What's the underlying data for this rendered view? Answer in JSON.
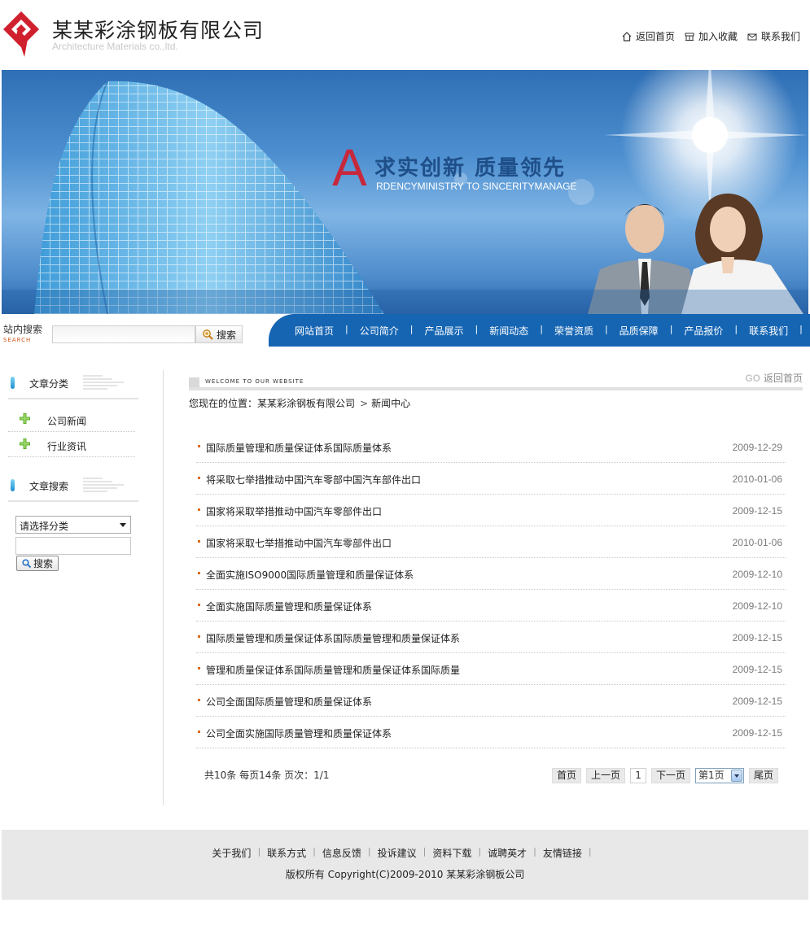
{
  "header": {
    "company_name": "某某彩涂钢板有限公司",
    "company_en": "Architecture Materials co.,ltd.",
    "links": [
      {
        "label": "返回首页",
        "icon": "home-icon"
      },
      {
        "label": "加入收藏",
        "icon": "favorites-icon"
      },
      {
        "label": "联系我们",
        "icon": "mail-icon"
      }
    ]
  },
  "banner": {
    "title_letter": "A",
    "title": "求实创新 质量领先",
    "subtitle": "RDENCYMINISTRY TO SINCERITYMANAGE"
  },
  "site_search": {
    "label": "站内搜索",
    "label_en": "SEARCH",
    "button": "搜索"
  },
  "nav": {
    "items": [
      "网站首页",
      "公司简介",
      "产品展示",
      "新闻动态",
      "荣誉资质",
      "品质保障",
      "产品报价",
      "联系我们"
    ]
  },
  "sidebar": {
    "category_title": "文章分类",
    "categories": [
      "公司新闻",
      "行业资讯"
    ],
    "search_title": "文章搜索",
    "select_value": "请选择分类",
    "search_button": "搜索"
  },
  "main": {
    "welcome": "WELCOME TO OUR WEBSITE",
    "go_back_prefix": "GO",
    "go_back": "返回首页",
    "breadcrumb_prefix": "您现在的位置：",
    "breadcrumb_home": "某某彩涂钢板有限公司",
    "breadcrumb_sep": ">",
    "breadcrumb_current": "新闻中心",
    "news": [
      {
        "title": "国际质量管理和质量保证体系国际质量体系",
        "date": "2009-12-29"
      },
      {
        "title": "将采取七举措推动中国汽车零部中国汽车部件出口",
        "date": "2010-01-06"
      },
      {
        "title": "国家将采取举措推动中国汽车零部件出口",
        "date": "2009-12-15"
      },
      {
        "title": "国家将采取七举措推动中国汽车零部件出口",
        "date": "2010-01-06"
      },
      {
        "title": "全面实施ISO9000国际质量管理和质量保证体系",
        "date": "2009-12-10"
      },
      {
        "title": "全面实施国际质量管理和质量保证体系",
        "date": "2009-12-10"
      },
      {
        "title": "国际质量管理和质量保证体系国际质量管理和质量保证体系",
        "date": "2009-12-15"
      },
      {
        "title": "管理和质量保证体系国际质量管理和质量保证体系国际质量",
        "date": "2009-12-15"
      },
      {
        "title": "公司全面国际质量管理和质量保证体系",
        "date": "2009-12-15"
      },
      {
        "title": "公司全面实施国际质量管理和质量保证体系",
        "date": "2009-12-15"
      }
    ],
    "pager": {
      "info": "共10条  每页14条  页次：1/1",
      "first": "首页",
      "prev": "上一页",
      "current": "1",
      "next": "下一页",
      "select": "第1页",
      "last": "尾页"
    }
  },
  "footer": {
    "links": [
      "关于我们",
      "联系方式",
      "信息反馈",
      "投诉建议",
      "资料下载",
      "诚聘英才",
      "友情链接"
    ],
    "copyright": "版权所有  Copyright(C)2009-2010 某某彩涂钢板公司"
  },
  "colors": {
    "nav_blue": "#1565b3",
    "logo_red": "#d0202e",
    "accent_orange": "#e06b12"
  }
}
